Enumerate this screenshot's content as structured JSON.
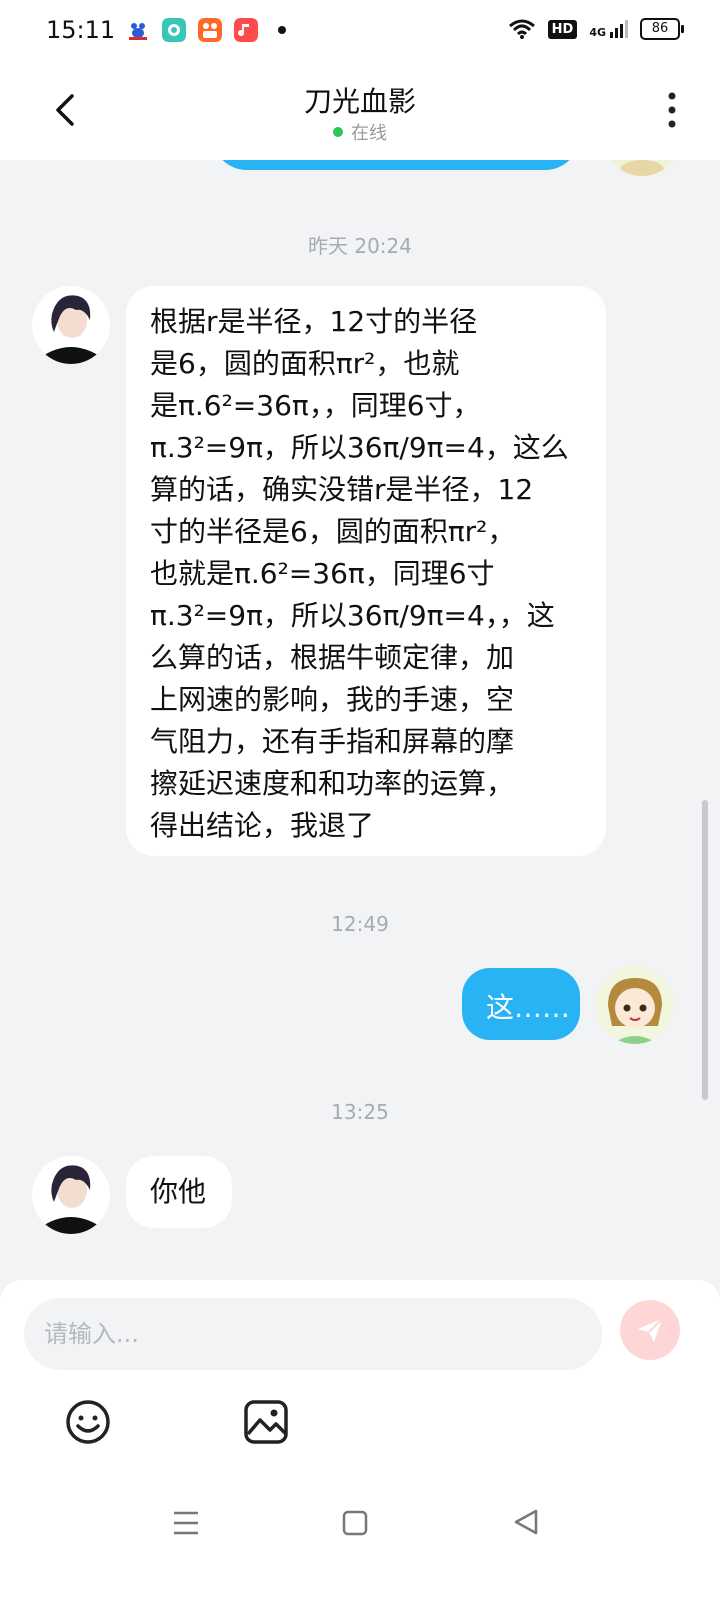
{
  "status_bar": {
    "time": "15:11",
    "network": "4G",
    "hd": "HD",
    "battery": "86",
    "app_icons": [
      "baidu-icon",
      "green-app-icon",
      "video-app-icon",
      "music-app-icon"
    ]
  },
  "header": {
    "title": "刀光血影",
    "presence": "在线"
  },
  "messages": {
    "ts_1": "昨天 20:24",
    "msg_1": "根据r是半径，12寸的半径\n是6，圆的面积πr²，也就\n是π.6²=36π，，同理6寸，\nπ.3²=9π，所以36π/9π=4，这么\n算的话，确实没错r是半径，12\n寸的半径是6，圆的面积πr²，\n也就是π.6²=36π，同理6寸\nπ.3²=9π，所以36π/9π=4，，这\n么算的话，根据牛顿定律，加\n上网速的影响，我的手速，空\n气阻力，还有手指和屏幕的摩\n擦延迟速度和和功率的运算，\n得出结论，我退了",
    "ts_2": "12:49",
    "msg_2": "这……",
    "ts_3": "13:25",
    "msg_3": "你他"
  },
  "composer": {
    "placeholder": "请输入..."
  },
  "colors": {
    "accent": "#28b3f4",
    "online": "#2bc84f",
    "send_disabled": "#ffd6d6",
    "background": "#f2f3f5"
  }
}
